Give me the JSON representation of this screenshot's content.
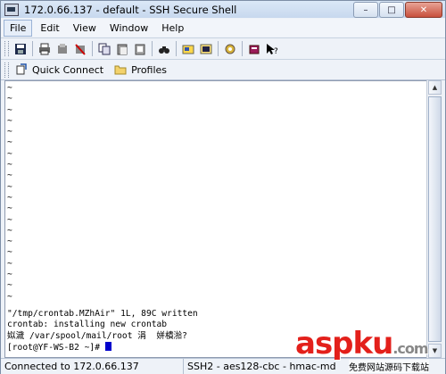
{
  "window": {
    "title": "172.0.66.137 - default - SSH Secure Shell"
  },
  "menu": [
    "File",
    "Edit",
    "View",
    "Window",
    "Help"
  ],
  "toolbar_icons": [
    "save-icon",
    "print-icon",
    "sftp-icon",
    "disconnect-icon",
    "copy-icon",
    "paste-icon",
    "find-icon",
    "settings-icon",
    "terminal-icon",
    "key-icon",
    "help-icon"
  ],
  "quickbar": {
    "quick_connect": "Quick Connect",
    "profiles": "Profiles"
  },
  "terminal": {
    "tilde": "~",
    "lines": [
      "\"/tmp/crontab.MZhAir\" 1L, 89C written",
      "crontab: installing new crontab",
      "姒濊 /var/spool/mail/root 涓  姘樻湁?",
      "[root@YF-WS-B2 ~]# "
    ]
  },
  "status": {
    "left": "Connected to 172.0.66.137",
    "right": "SSH2 - aes128-cbc - hmac-md"
  },
  "watermark": {
    "brand": "aspku",
    "suffix": ".com",
    "sub": "免费网站源码下载站"
  }
}
